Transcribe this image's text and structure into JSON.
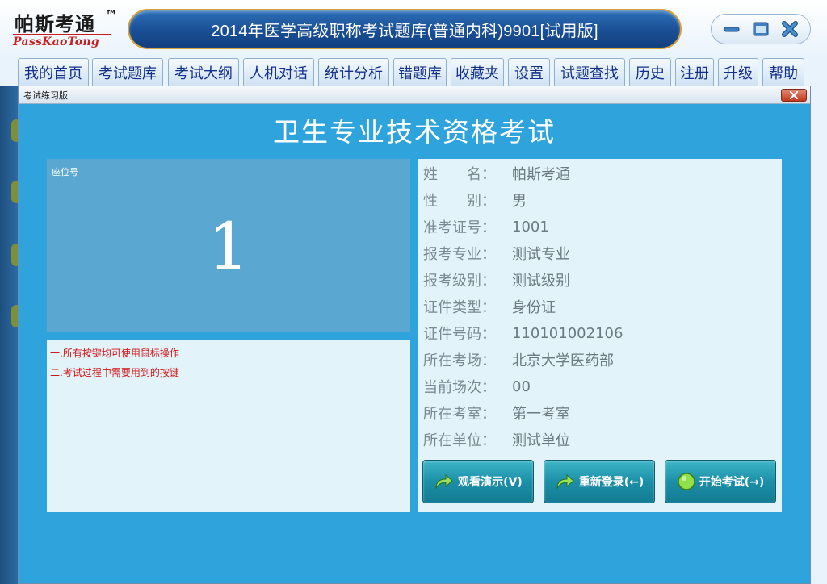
{
  "header": {
    "logo_cn": "帕斯考通",
    "logo_tm": "™",
    "logo_en": "PassKaoTong",
    "title": "2014年医学高级职称考试题库(普通内科)9901[试用版]"
  },
  "window_controls": {
    "minimize_icon": "minimize-icon",
    "restore_icon": "restore-icon",
    "close_icon": "close-icon"
  },
  "nav": {
    "tabs": [
      {
        "label": "我的首页"
      },
      {
        "label": "考试题库"
      },
      {
        "label": "考试大纲"
      },
      {
        "label": "人机对话"
      },
      {
        "label": "统计分析"
      },
      {
        "label": "错题库"
      },
      {
        "label": "收藏夹"
      },
      {
        "label": "设置"
      },
      {
        "label": "试题查找"
      },
      {
        "label": "历史"
      },
      {
        "label": "注册"
      },
      {
        "label": "升级"
      },
      {
        "label": "帮助"
      }
    ]
  },
  "dialog": {
    "title": "考试练习版",
    "heading": "卫生专业技术资格考试",
    "seat_label": "座位号",
    "seat_number": "1",
    "notes": [
      "一.所有按键均可使用鼠标操作",
      "二.考试过程中需要用到的按键"
    ],
    "info": [
      {
        "label": "姓　　名：",
        "value": "帕斯考通"
      },
      {
        "label": "性　　别：",
        "value": "男"
      },
      {
        "label": "准考证号：",
        "value": "1001"
      },
      {
        "label": "报考专业：",
        "value": "测试专业"
      },
      {
        "label": "报考级别：",
        "value": "测试级别"
      },
      {
        "label": "证件类型：",
        "value": "身份证"
      },
      {
        "label": "证件号码：",
        "value": "110101002106"
      },
      {
        "label": "所在考场：",
        "value": "北京大学医药部"
      },
      {
        "label": "当前场次：",
        "value": "00"
      },
      {
        "label": "所在考室：",
        "value": "第一考室"
      },
      {
        "label": "所在单位：",
        "value": "测试单位"
      }
    ],
    "buttons": {
      "demo": "观看演示(V)",
      "relogin": "重新登录(←)",
      "start": "开始考试(→)"
    }
  },
  "colors": {
    "dialog_bg": "#2ea3dc",
    "title_capsule": "#1a4f95",
    "note_text": "#d21414"
  }
}
